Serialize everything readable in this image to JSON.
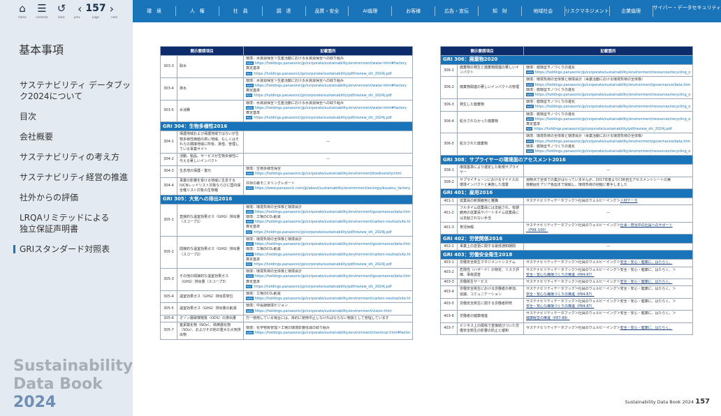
{
  "toolbar": {
    "home": {
      "label": "home",
      "icon": "home-icon"
    },
    "contents": {
      "label": "contents",
      "icon": "list-icon"
    },
    "back": {
      "label": "back",
      "icon": "undo-icon"
    },
    "prev_label": "prev",
    "page_label": "page",
    "next_label": "next",
    "page_number": "157"
  },
  "categories": [
    "環　境",
    "人　権",
    "社　員",
    "調　達",
    "品質・安全",
    "AI倫理",
    "お客様",
    "広告・宣伝",
    "知　財",
    "地域社会",
    "リスクマネジメント",
    "企業倫理",
    "サイバー・データセキュリティ"
  ],
  "sidebar": {
    "title": "基本事項",
    "items": [
      "サステナビリティ データブック2024について",
      "目次",
      "会社概要",
      "サステナビリティの考え方",
      "サステナビリティ経営の推進",
      "社外からの評価",
      "LRQAリミテッドによる独立保証声明書",
      "GRIスタンダード対照表"
    ],
    "brand": [
      "Sustainability",
      "Data Book",
      "2024"
    ]
  },
  "table": {
    "headers": [
      "開示要請項目",
      "記載箇所"
    ]
  },
  "left_rows": [
    {
      "type": "row",
      "code": "303-3",
      "item": "取水",
      "content": [
        {
          "t": "環境：水資源保全＞生産活動における水資源保全への取り組み"
        },
        {
          "u": "https://holdings.panasonic/jp/corporate/sustainability/environment/water.html#factory"
        },
        {
          "t": "算定基準"
        },
        {
          "p": "https://holdings.panasonic/jp/corporate/sustainability/pdf/review_sfc_2024j.pdf"
        }
      ]
    },
    {
      "type": "row",
      "code": "303-4",
      "item": "排水",
      "content": [
        {
          "t": "環境：水資源保全＞生産活動における水資源保全への取り組み"
        },
        {
          "u": "https://holdings.panasonic/jp/corporate/sustainability/environment/water.html#factory"
        },
        {
          "t": "算定基準"
        },
        {
          "p": "https://holdings.panasonic/jp/corporate/sustainability/pdf/review_sfc_2024j.pdf"
        }
      ]
    },
    {
      "type": "row",
      "code": "303-5",
      "item": "水消費",
      "content": [
        {
          "t": "環境：水資源保全＞生産活動における水資源保全への取り組み"
        },
        {
          "u": "https://holdings.panasonic/jp/corporate/sustainability/environment/water.html#factory"
        },
        {
          "t": "算定基準"
        },
        {
          "p": "https://holdings.panasonic/jp/corporate/sustainability/pdf/review_sfc_2024j.pdf"
        }
      ]
    },
    {
      "type": "sec",
      "title": "GRI 304：生物多様性2016"
    },
    {
      "type": "row",
      "code": "304-1",
      "item": "保護地域および保護地域ではないが生物多様性価値の高い地域、もしくはそれらの隣接地域に所有、賃借、管理している事業サイト",
      "content": [
        {
          "d": "—"
        }
      ]
    },
    {
      "type": "row",
      "code": "304-2",
      "item": "活動、製品、サービスが生物多様性に与える著しいインパクト",
      "content": [
        {
          "d": "—"
        }
      ]
    },
    {
      "type": "row",
      "code": "304-3",
      "item": "生息地の保護・復元",
      "content": [
        {
          "t": "環境：生物多様性保全"
        },
        {
          "u": "https://holdings.panasonic/jp/corporate/sustainability/environment/biodiversity.html"
        }
      ]
    },
    {
      "type": "row",
      "code": "304-4",
      "item": "事業の影響を受ける地域に生息するIUCNレッドリスト対象ならびに国内保全種リスト対象の生物種",
      "content": [
        {
          "t": "共存の森モニタリングレポート"
        },
        {
          "u": "https://www.panasonic.com/jp/about/sustainability/environment/ecology/kusatsu_factory.html"
        }
      ]
    },
    {
      "type": "sec",
      "title": "GRI 305：大気への排出2016"
    },
    {
      "type": "row",
      "code": "305-1",
      "item": "直接的な温室効果ガス（GHG）排出量（スコープ1）",
      "content": [
        {
          "t": "環境：環境負荷の全体像と環境会計"
        },
        {
          "u": "https://holdings.panasonic/jp/corporate/sustainability/environment/governance/data.html"
        },
        {
          "t": "環境：工場のCO₂削減"
        },
        {
          "u": "https://holdings.panasonic/jp/corporate/sustainability/environment/carbon-neutral/site.html"
        },
        {
          "t": "算定基準"
        },
        {
          "p": "https://holdings.panasonic/jp/corporate/sustainability/pdf/review_sfc_2024j.pdf"
        }
      ]
    },
    {
      "type": "row",
      "code": "305-2",
      "item": "間接的な温室効果ガス（GHG）排出量（スコープ2）",
      "content": [
        {
          "t": "環境：環境負荷の全体像と環境会計"
        },
        {
          "u": "https://holdings.panasonic/jp/corporate/sustainability/environment/governance/data.html"
        },
        {
          "t": "環境：工場のCO₂削減"
        },
        {
          "u": "https://holdings.panasonic/jp/corporate/sustainability/environment/carbon-neutral/site.html"
        },
        {
          "t": "算定基準"
        },
        {
          "p": "https://holdings.panasonic/jp/corporate/sustainability/pdf/review_sfc_2024j.pdf"
        }
      ]
    },
    {
      "type": "row",
      "code": "305-3",
      "item": "その他の間接的な温室効果ガス（GHG）排出量（スコープ3）",
      "content": [
        {
          "t": "環境：環境負荷の全体像と環境会計"
        },
        {
          "u": "https://holdings.panasonic/jp/corporate/sustainability/environment/governance/data.html"
        },
        {
          "t": "算定基準"
        },
        {
          "p": "https://holdings.panasonic/jp/corporate/sustainability/pdf/review_sfc_2024j.pdf"
        }
      ]
    },
    {
      "type": "row",
      "code": "305-4",
      "item": "温室効果ガス（GHG）排出原単位",
      "content": [
        {
          "t": "環境：工場のCO₂削減"
        },
        {
          "u": "https://holdings.panasonic/jp/corporate/sustainability/environment/carbon-neutral/site.html"
        }
      ]
    },
    {
      "type": "row",
      "code": "305-5",
      "item": "温室効果ガス（GHG）排出量の削減",
      "content": [
        {
          "t": "環境：中長期環境ビジョン"
        },
        {
          "u": "https://holdings.panasonic/jp/corporate/sustainability/environment/vision.html"
        }
      ]
    },
    {
      "type": "row",
      "code": "305-6",
      "item": "オゾン層破壊物質（ODS）の排出量",
      "content": [
        {
          "t": "万一使用している場合には、目的に使用中止しなければならない物質として管理しています"
        }
      ]
    },
    {
      "type": "row",
      "code": "305-7",
      "item": "窒素酸化物（NOx）、硫黄酸化物（SOx）、およびその他の重大な大気排出物",
      "content": [
        {
          "t": "環境：化学物質管理＞工場の環境影響低減の取り組み"
        },
        {
          "u": "https://holdings.panasonic/jp/corporate/sustainability/environment/chemical.html#factory"
        }
      ]
    }
  ],
  "right_rows": [
    {
      "type": "sec",
      "title": "GRI 306：廃棄物2020"
    },
    {
      "type": "row",
      "code": "306-1",
      "item": "廃棄物の発生と廃棄物関連の著しいインパクト",
      "content": [
        {
          "t": "環境：循環型モノづくりの進化"
        },
        {
          "u": "https://holdings.panasonic/jp/corporate/sustainability/environment/resources/recycling_oriented_manufacturing.html"
        }
      ]
    },
    {
      "type": "row",
      "code": "306-2",
      "item": "廃棄物関連の著しいインパクトの管理",
      "content": [
        {
          "t": "環境：環境負荷の全体像と環境会計（事業活動における環境負荷の全体像）"
        },
        {
          "u": "https://holdings.panasonic/jp/corporate/sustainability/environment/governance/data.html"
        },
        {
          "t": "環境：循環型モノづくりの進化"
        },
        {
          "u": "https://holdings.panasonic/jp/corporate/sustainability/environment/resources/recycling_oriented_manufacturing.html"
        }
      ]
    },
    {
      "type": "row",
      "code": "306-3",
      "item": "発生した廃棄物",
      "content": [
        {
          "t": "環境：循環型モノづくりの進化"
        },
        {
          "u": "https://holdings.panasonic/jp/corporate/sustainability/environment/resources/recycling_oriented_manufacturing.html"
        }
      ]
    },
    {
      "type": "row",
      "code": "306-4",
      "item": "処分されなかった廃棄物",
      "content": [
        {
          "t": "環境：循環型モノづくりの進化"
        },
        {
          "u": "https://holdings.panasonic/jp/corporate/sustainability/environment/resources/recycling_oriented_manufacturing.html"
        },
        {
          "t": "算定基準"
        },
        {
          "p": "https://holdings.panasonic/jp/corporate/sustainability/pdf/review_sfc_2024j.pdf"
        }
      ]
    },
    {
      "type": "row",
      "code": "306-5",
      "item": "処分された廃棄物",
      "content": [
        {
          "t": "環境：環境負荷の全体像と環境会計（事業活動における環境負荷の全体像）"
        },
        {
          "u": "https://holdings.panasonic/jp/corporate/sustainability/environment/governance/data.html"
        },
        {
          "t": "環境：循環型モノづくりの進化"
        },
        {
          "u": "https://holdings.panasonic/jp/corporate/sustainability/environment/resources/recycling_oriented_manufacturing.html"
        }
      ]
    },
    {
      "type": "sec",
      "title": "GRI 308：サプライヤーの環境面のアセスメント2016"
    },
    {
      "type": "row",
      "code": "308-1",
      "item": "環境基準により選定した新規サプライヤー",
      "content": [
        {
          "d": "—"
        }
      ]
    },
    {
      "type": "row",
      "code": "308-2",
      "item": "サプライチェーンにおけるマイナスの環境インパクトと実施した措置",
      "content": [
        {
          "t": "現時点で全体での集計は行っていませんが、2017年度よりCSR自主アセスメントシートの実"
        },
        {
          "t": "施範囲をアジア各国まで展開し、環境負荷の把握に着手しました"
        }
      ]
    },
    {
      "type": "sec",
      "title": "GRI 401：雇用2016"
    },
    {
      "type": "row",
      "code": "401-1",
      "item": "従業員の新規雇用と離職",
      "content": [
        {
          "t": "サステナビリティデータブック＞社員のウェルビーイング＞",
          "l": "人材データ"
        }
      ]
    },
    {
      "type": "row",
      "code": "401-2",
      "item": "フルタイム従業員には支給され、有期雇用の従業員やパートタイム従業員には支給されない手当",
      "content": [
        {
          "d": "—"
        }
      ]
    },
    {
      "type": "row",
      "code": "401-3",
      "item": "育児休暇",
      "content": [
        {
          "t": "サステナビリティデータブック＞社員のウェルビーイング＞",
          "l": "仕事・育児中の社員へのサポート"
        },
        {
          "l": "（P99–100）"
        }
      ]
    },
    {
      "type": "sec",
      "title": "GRI 402：労使関係2016"
    },
    {
      "type": "row",
      "code": "402-1",
      "item": "事業上の変更に関する最低通知期間",
      "content": [
        {
          "d": "—"
        }
      ]
    },
    {
      "type": "sec",
      "title": "GRI 403：労働安全衛生2018"
    },
    {
      "type": "row",
      "code": "403-1",
      "item": "労働安全衛生マネジメントシステム",
      "content": [
        {
          "t": "サステナビリティデータブック＞社員のウェルビーイング＞",
          "l": "安全・安心・健康に、はたらく。"
        }
      ]
    },
    {
      "type": "row",
      "code": "403-2",
      "item": "危険性（ハザード）の特定、リスク評価、事故調査",
      "content": [
        {
          "t": "サステナビリティデータブック＞社員のウェルビーイング＞安全・安心・健康に、はたらく。＞"
        },
        {
          "l": "安全・安心な職場づくりの推進（P84-87）"
        }
      ]
    },
    {
      "type": "row",
      "code": "403-3",
      "item": "労働衛生サービス",
      "content": [
        {
          "t": "サステナビリティデータブック＞社員のウェルビーイング＞",
          "l": "安全・安心・健康に、はたらく。"
        }
      ]
    },
    {
      "type": "row",
      "code": "403-4",
      "item": "労働安全衛生における労働者の参加、協議、コミュニケーション",
      "content": [
        {
          "t": "サステナビリティデータブック＞社員のウェルビーイング＞安全・安心・健康に、はたらく。＞"
        },
        {
          "l": "安全・安心な職場づくりの推進（P84-87）"
        }
      ]
    },
    {
      "type": "row",
      "code": "403-5",
      "item": "労働安全衛生に関する労働者研修",
      "content": [
        {
          "t": "サステナビリティデータブック＞社員のウェルビーイング＞安全・安心・健康に、はたらく。＞"
        },
        {
          "l": "安全・安心な職場づくりの推進（P84-87）"
        }
      ]
    },
    {
      "type": "row",
      "code": "403-6",
      "item": "労働者の健康増進",
      "content": [
        {
          "t": "サステナビリティデータブック＞社員のウェルビーイング＞安全・安心・健康に、はたらく。＞"
        },
        {
          "l": "健康経営の推進（P87-89）"
        }
      ]
    },
    {
      "type": "row",
      "code": "403-7",
      "item": "ビジネス上の関係で直接結びついた労働安全衛生の影響の防止と緩和",
      "content": [
        {
          "t": "サステナビリティデータブック＞社員のウェルビーイング＞",
          "l": "安全・安心・健康に、はたらく。"
        }
      ]
    }
  ],
  "footer": {
    "text": "Sustainability Data Book 2024",
    "page": "157"
  },
  "colors": {
    "topbar": "#1a74b9",
    "header": "#0d2c6b",
    "section": "#1a74b9",
    "sidebar": "#e4eaf1"
  }
}
